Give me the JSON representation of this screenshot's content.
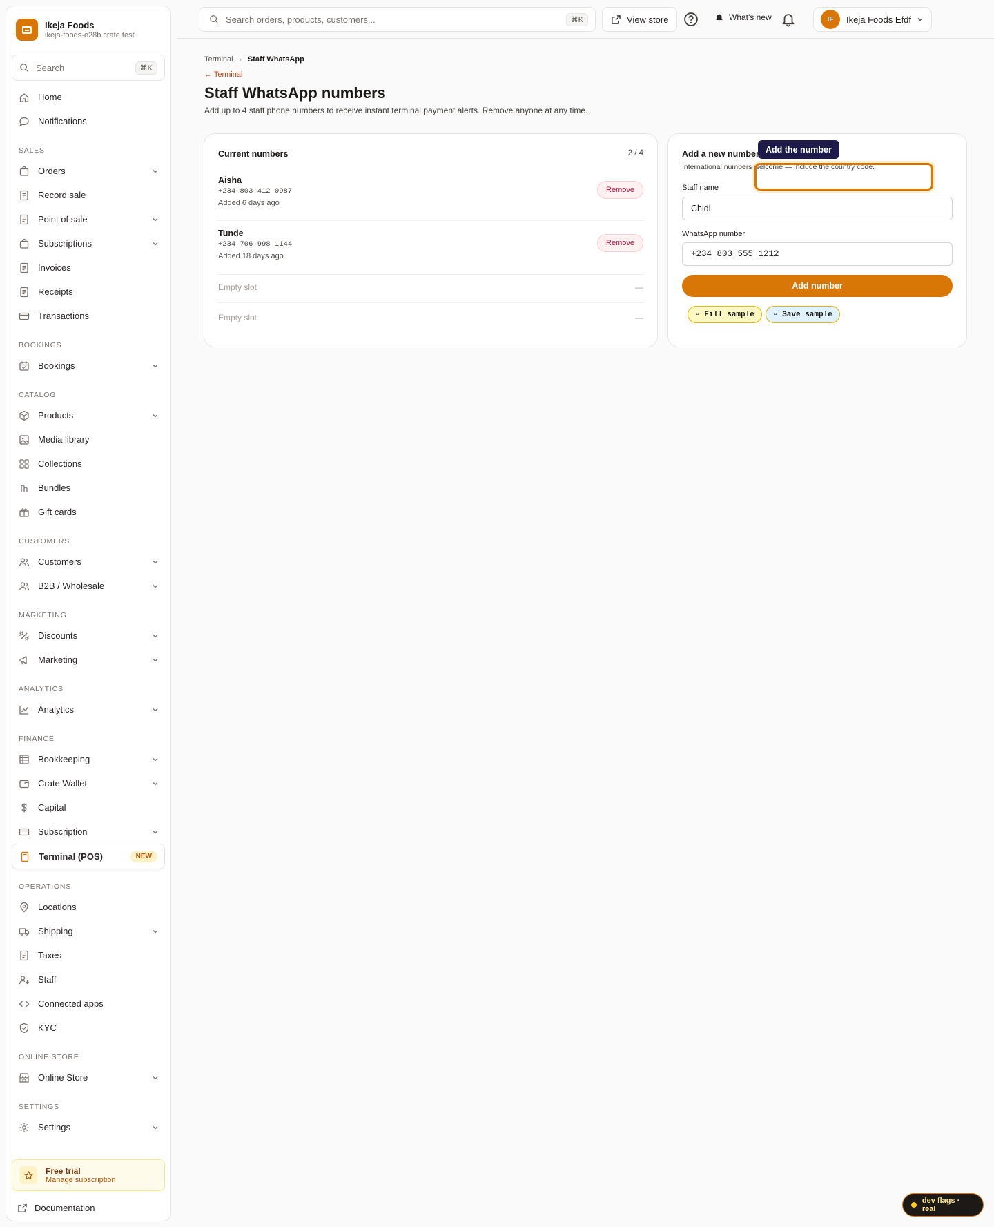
{
  "brand": {
    "name": "Ikeja Foods",
    "url": "ikeja-foods-e28b.crate.test"
  },
  "sidebar": {
    "search_label": "Search",
    "search_kbd": "⌘K",
    "top_items": [
      {
        "label": "Home"
      },
      {
        "label": "Notifications"
      }
    ],
    "sections": {
      "sales": "SALES",
      "bookings": "BOOKINGS",
      "catalog": "CATALOG",
      "customers": "CUSTOMERS",
      "marketing": "MARKETING",
      "analytics": "ANALYTICS",
      "finance": "FINANCE",
      "operations": "OPERATIONS",
      "online_store": "ONLINE STORE",
      "settings": "SETTINGS"
    },
    "sales_items": [
      "Orders",
      "Record sale",
      "Point of sale",
      "Subscriptions",
      "Invoices",
      "Receipts",
      "Transactions"
    ],
    "bookings_items": [
      "Bookings"
    ],
    "catalog_items": [
      "Products",
      "Media library",
      "Collections",
      "Bundles",
      "Gift cards"
    ],
    "customers_items": [
      "Customers",
      "B2B / Wholesale"
    ],
    "marketing_items": [
      "Discounts",
      "Marketing"
    ],
    "analytics_items": [
      "Analytics"
    ],
    "finance_items": [
      "Bookkeeping",
      "Crate Wallet",
      "Capital",
      "Subscription"
    ],
    "active_item": {
      "label": "Terminal (POS)",
      "badge": "NEW"
    },
    "operations_items": [
      "Locations",
      "Shipping",
      "Taxes",
      "Staff",
      "Connected apps",
      "KYC"
    ],
    "online_store_items": [
      "Online Store"
    ],
    "settings_items": [
      "Settings"
    ],
    "trial": {
      "title": "Free trial",
      "subtitle": "Manage subscription"
    },
    "documentation": "Documentation"
  },
  "topbar": {
    "search_placeholder": "Search orders, products, customers...",
    "search_kbd": "⌘K",
    "view_store": "View store",
    "whats_new": "What's new",
    "user_initials": "IF",
    "user_name": "Ikeja Foods Efdf"
  },
  "page": {
    "breadcrumb_parent": "Terminal",
    "breadcrumb_current": "Staff WhatsApp",
    "back_link": "← Terminal",
    "title": "Staff WhatsApp numbers",
    "subtitle": "Add up to 4 staff phone numbers to receive instant terminal payment alerts. Remove anyone at any time."
  },
  "current": {
    "heading": "Current numbers",
    "count": "2 / 4",
    "entries": [
      {
        "name": "Aisha",
        "phone": "+234 803 412 0987",
        "added": "Added 6 days ago",
        "action": "Remove"
      },
      {
        "name": "Tunde",
        "phone": "+234 706 998 1144",
        "added": "Added 18 days ago",
        "action": "Remove"
      }
    ],
    "empty_label": "Empty slot",
    "empty_dash": "—"
  },
  "form": {
    "heading": "Add a new number",
    "hint": "International numbers welcome — include the country code.",
    "name_label": "Staff name",
    "name_value": "Chidi",
    "phone_label": "WhatsApp number",
    "phone_value": "+234 803 555 1212",
    "submit": "Add number",
    "fill_sample": "▫ Fill sample",
    "save_sample": "▫ Save sample"
  },
  "overlay": {
    "tooltip": "Add the number"
  },
  "devflag": {
    "label": "dev flags · real"
  },
  "colors": {
    "accent": "#d97706",
    "danger": "#be123c",
    "tooltip_bg": "#1e1b4b"
  }
}
